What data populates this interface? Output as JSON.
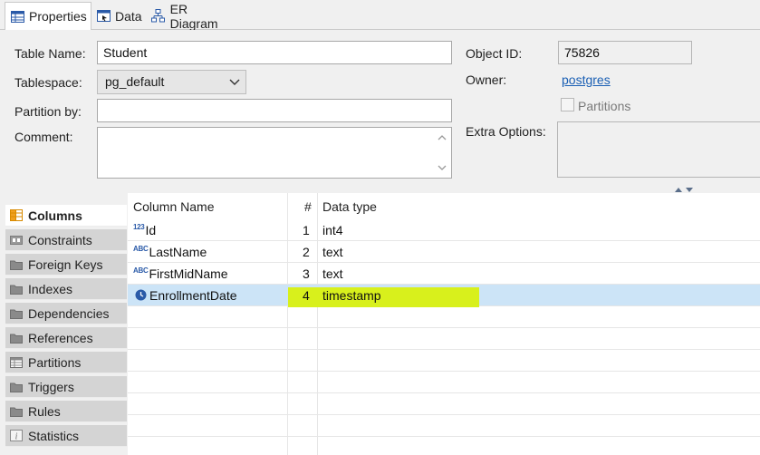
{
  "tabs": [
    {
      "label": "Properties",
      "icon": "properties-icon",
      "active": true
    },
    {
      "label": "Data",
      "icon": "data-icon",
      "active": false
    },
    {
      "label": "ER Diagram",
      "icon": "er-diagram-icon",
      "active": false
    }
  ],
  "properties": {
    "table_name_label": "Table Name:",
    "table_name_value": "Student",
    "tablespace_label": "Tablespace:",
    "tablespace_value": "pg_default",
    "partition_by_label": "Partition by:",
    "partition_by_value": "",
    "comment_label": "Comment:",
    "comment_value": "",
    "object_id_label": "Object ID:",
    "object_id_value": "75826",
    "owner_label": "Owner:",
    "owner_value": "postgres",
    "partitions_label": "Partitions",
    "extra_options_label": "Extra Options:"
  },
  "nav": {
    "items": [
      {
        "label": "Columns",
        "icon": "columns-icon",
        "active": true
      },
      {
        "label": "Constraints",
        "icon": "constraints-icon",
        "active": false
      },
      {
        "label": "Foreign Keys",
        "icon": "folder-icon",
        "active": false
      },
      {
        "label": "Indexes",
        "icon": "folder-icon",
        "active": false
      },
      {
        "label": "Dependencies",
        "icon": "folder-icon",
        "active": false
      },
      {
        "label": "References",
        "icon": "folder-icon",
        "active": false
      },
      {
        "label": "Partitions",
        "icon": "partitions-icon",
        "active": false
      },
      {
        "label": "Triggers",
        "icon": "folder-icon",
        "active": false
      },
      {
        "label": "Rules",
        "icon": "folder-icon",
        "active": false
      },
      {
        "label": "Statistics",
        "icon": "info-icon",
        "active": false
      }
    ]
  },
  "grid": {
    "headers": {
      "name": "Column Name",
      "num": "#",
      "type": "Data type"
    },
    "rows": [
      {
        "icon_text": "123",
        "icon": "numeric-type-icon",
        "name": "Id",
        "num": "1",
        "type": "int4",
        "selected": false
      },
      {
        "icon_text": "ABC",
        "icon": "text-type-icon",
        "name": "LastName",
        "num": "2",
        "type": "text",
        "selected": false
      },
      {
        "icon_text": "ABC",
        "icon": "text-type-icon",
        "name": "FirstMidName",
        "num": "3",
        "type": "text",
        "selected": false
      },
      {
        "icon_text": "",
        "icon": "clock-icon",
        "name": "EnrollmentDate",
        "num": "4",
        "type": "timestamp",
        "selected": true
      }
    ]
  },
  "colors": {
    "selection": "#cce4f7",
    "highlight": "#d8f01c",
    "link": "#1a5fb4",
    "icon_blue": "#2a5aa8"
  }
}
